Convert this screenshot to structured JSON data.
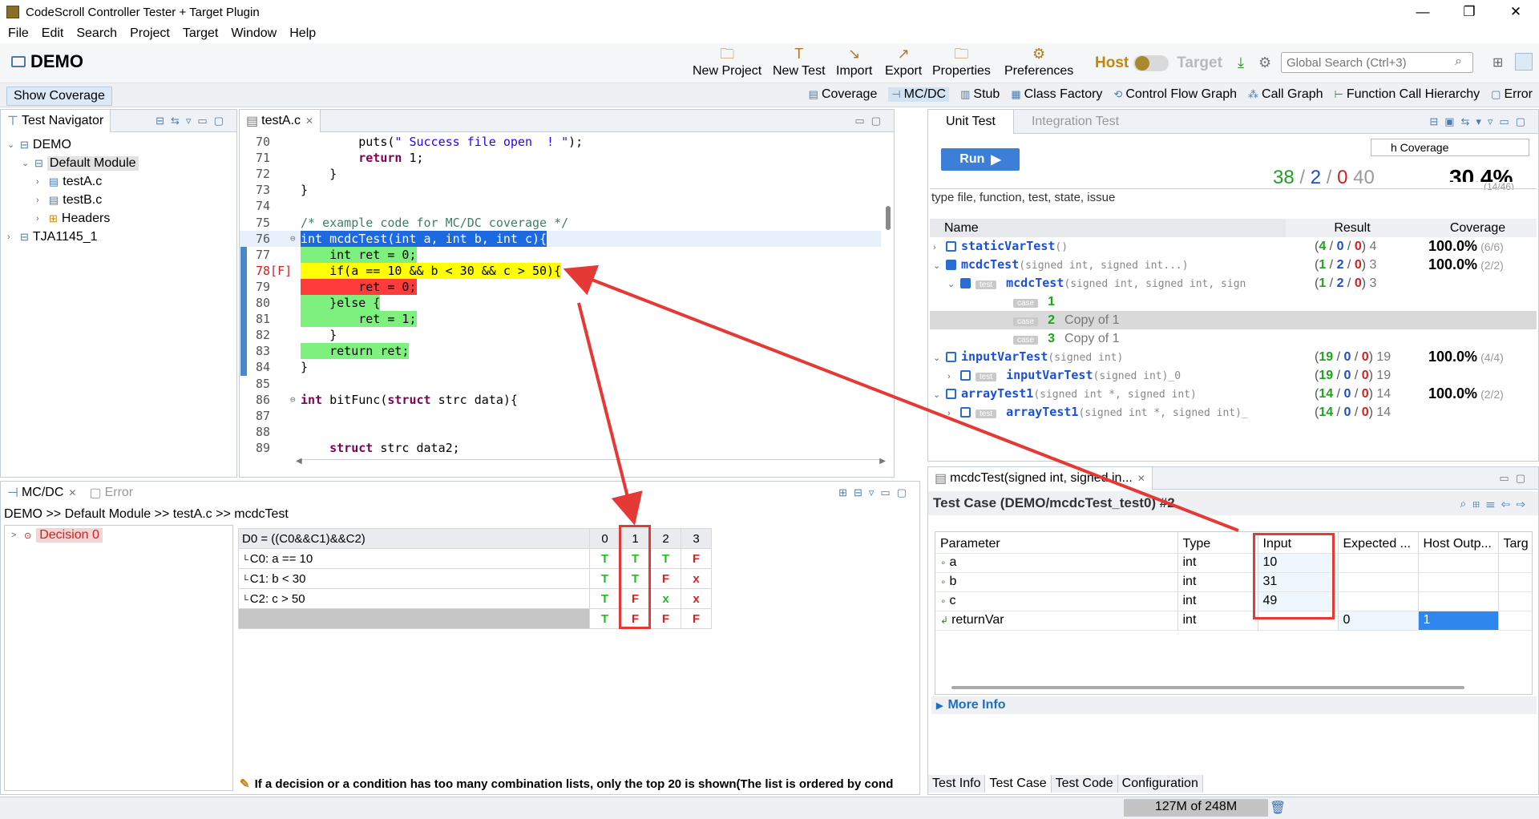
{
  "window": {
    "title": "CodeScroll Controller Tester + Target Plugin",
    "minimize": "—",
    "restore": "❐",
    "close": "✕"
  },
  "menu": [
    "File",
    "Edit",
    "Search",
    "Project",
    "Target",
    "Window",
    "Help"
  ],
  "toolbar": {
    "project": "DEMO",
    "buttons": [
      {
        "label": "New Project",
        "icon": "new-project-icon"
      },
      {
        "label": "New Test",
        "icon": "new-test-icon"
      },
      {
        "label": "Import",
        "icon": "import-icon"
      },
      {
        "label": "Export",
        "icon": "export-icon"
      },
      {
        "label": "Properties",
        "icon": "properties-icon"
      },
      {
        "label": "Preferences",
        "icon": "preferences-icon"
      }
    ],
    "host": "Host",
    "target": "Target",
    "search_placeholder": "Global Search (Ctrl+3)"
  },
  "viewbar": {
    "show_coverage": "Show Coverage",
    "tabs": [
      "Coverage",
      "MC/DC",
      "Stub",
      "Class Factory",
      "Control Flow Graph",
      "Call Graph",
      "Function Call Hierarchy",
      "Error"
    ]
  },
  "navigator": {
    "tab": "Test Navigator",
    "items": [
      {
        "label": "DEMO",
        "indent": 0,
        "expanded": true
      },
      {
        "label": "Default Module",
        "indent": 1,
        "expanded": true,
        "selected": true
      },
      {
        "label": "testA.c",
        "indent": 2
      },
      {
        "label": "testB.c",
        "indent": 2
      },
      {
        "label": "Headers",
        "indent": 2
      },
      {
        "label": "TJA1145_1",
        "indent": 0
      }
    ]
  },
  "editor": {
    "tab": "testA.c",
    "lines": [
      {
        "n": "70",
        "text": "        puts(\" Success file open  ! \");",
        "hl": ""
      },
      {
        "n": "71",
        "text": "        return 1;",
        "hl": ""
      },
      {
        "n": "72",
        "text": "    }",
        "hl": ""
      },
      {
        "n": "73",
        "text": "}",
        "hl": ""
      },
      {
        "n": "74",
        "text": "",
        "hl": ""
      },
      {
        "n": "75",
        "text": "/* example code for MC/DC coverage */",
        "hl": "cmt"
      },
      {
        "n": "76",
        "text": "int mcdcTest(int a, int b, int c){",
        "hl": "blue"
      },
      {
        "n": "77",
        "text": "    int ret = 0;",
        "hl": "green"
      },
      {
        "n": "78[F]",
        "text": "    if(a == 10 && b < 30 && c > 50){",
        "hl": "yellow"
      },
      {
        "n": "79",
        "text": "        ret = 0;",
        "hl": "red"
      },
      {
        "n": "80",
        "text": "    }else {",
        "hl": "green"
      },
      {
        "n": "81",
        "text": "        ret = 1;",
        "hl": "green"
      },
      {
        "n": "82",
        "text": "    }",
        "hl": ""
      },
      {
        "n": "83",
        "text": "    return ret;",
        "hl": "green"
      },
      {
        "n": "84",
        "text": "}",
        "hl": ""
      },
      {
        "n": "85",
        "text": "",
        "hl": ""
      },
      {
        "n": "86",
        "text": "int bitFunc(struct strc data){",
        "hl": ""
      },
      {
        "n": "87",
        "text": "",
        "hl": ""
      },
      {
        "n": "88",
        "text": "",
        "hl": ""
      },
      {
        "n": "89",
        "text": "    struct strc data2;",
        "hl": ""
      }
    ]
  },
  "mcdc": {
    "tab": "MC/DC",
    "tab2": "Error",
    "breadcrumb": "DEMO >> Default Module >> testA.c >> mcdcTest",
    "decision": "Decision 0",
    "header": "D0 = ((C0&&C1)&&C2)",
    "cols": [
      "0",
      "1",
      "2",
      "3"
    ],
    "rows": [
      {
        "label": "C0: a == 10",
        "vals": [
          "T",
          "T",
          "T",
          "F"
        ]
      },
      {
        "label": "C1: b < 30",
        "vals": [
          "T",
          "T",
          "F",
          "x"
        ]
      },
      {
        "label": "C2: c > 50",
        "vals": [
          "T",
          "F",
          "x",
          "x"
        ]
      }
    ],
    "result": [
      "T",
      "F",
      "F",
      "F"
    ],
    "note": "If a decision or a condition has too many combination lists, only the top 20 is shown(The list is ordered by cond"
  },
  "unittest": {
    "tab": "Unit Test",
    "tab2": "Integration Test",
    "run": "Run",
    "cov_select": "h Coverage",
    "summary": {
      "a": "38",
      "b": "2",
      "c": "0",
      "d": "40",
      "pct": "30.4%",
      "sub": "(14/46)"
    },
    "filter": "type file, function, test, state, issue",
    "headers": [
      "Name",
      "Result",
      "Coverage"
    ],
    "rows": [
      {
        "level": 0,
        "tw": ">",
        "check": false,
        "tag": "",
        "name": "staticVarTest",
        "sig": "()",
        "r": [
          "4",
          "0",
          "0",
          "4"
        ],
        "pct": "100.0%",
        "psub": "(6/6)"
      },
      {
        "level": 0,
        "tw": "v",
        "check": true,
        "tag": "",
        "name": "mcdcTest",
        "sig": "(signed int, signed int...)",
        "r": [
          "1",
          "2",
          "0",
          "3"
        ],
        "pct": "100.0%",
        "psub": "(2/2)"
      },
      {
        "level": 1,
        "tw": "v",
        "check": true,
        "tag": "test",
        "name": "mcdcTest",
        "sig": "(signed int, signed int, sign",
        "r": [
          "1",
          "2",
          "0",
          "3"
        ],
        "pct": "",
        "psub": ""
      },
      {
        "level": 2,
        "tw": "",
        "check": false,
        "tag": "case",
        "name": "1",
        "sig": "",
        "r": [],
        "pct": "",
        "psub": "",
        "case": true
      },
      {
        "level": 2,
        "tw": "",
        "check": false,
        "tag": "case",
        "name": "2",
        "sig": "Copy of 1",
        "r": [],
        "pct": "",
        "psub": "",
        "case": true,
        "selected": true
      },
      {
        "level": 2,
        "tw": "",
        "check": false,
        "tag": "case",
        "name": "3",
        "sig": "Copy of 1",
        "r": [],
        "pct": "",
        "psub": "",
        "case": true
      },
      {
        "level": 0,
        "tw": "v",
        "check": false,
        "tag": "",
        "name": "inputVarTest",
        "sig": "(signed int)",
        "r": [
          "19",
          "0",
          "0",
          "19"
        ],
        "pct": "100.0%",
        "psub": "(4/4)"
      },
      {
        "level": 1,
        "tw": ">",
        "check": false,
        "tag": "test",
        "name": "inputVarTest",
        "sig": "(signed int)_0",
        "r": [
          "19",
          "0",
          "0",
          "19"
        ],
        "pct": "",
        "psub": ""
      },
      {
        "level": 0,
        "tw": "v",
        "check": false,
        "tag": "",
        "name": "arrayTest1",
        "sig": "(signed int *, signed int)",
        "r": [
          "14",
          "0",
          "0",
          "14"
        ],
        "pct": "100.0%",
        "psub": "(2/2)"
      },
      {
        "level": 1,
        "tw": ">",
        "check": false,
        "tag": "test",
        "name": "arrayTest1",
        "sig": "(signed int *, signed int)_",
        "r": [
          "14",
          "0",
          "0",
          "14"
        ],
        "pct": "",
        "psub": ""
      }
    ]
  },
  "testcase": {
    "tab": "mcdcTest(signed int, signed in...",
    "title": "Test Case (DEMO/mcdcTest_test0) #2",
    "headers": [
      "Parameter",
      "Type",
      "Input",
      "Expected ...",
      "Host Outp...",
      "Targ"
    ],
    "params": [
      {
        "name": "a",
        "type": "int",
        "input": "10",
        "expected": "",
        "host": ""
      },
      {
        "name": "b",
        "type": "int",
        "input": "31",
        "expected": "",
        "host": ""
      },
      {
        "name": "c",
        "type": "int",
        "input": "49",
        "expected": "",
        "host": ""
      },
      {
        "name": "returnVar",
        "type": "int",
        "input": "",
        "expected": "0",
        "host": "1"
      }
    ],
    "more_info": "More Info",
    "bottom_tabs": [
      "Test Info",
      "Test Case",
      "Test Code",
      "Configuration"
    ]
  },
  "status": {
    "memory": "127M of 248M"
  },
  "colors": {
    "accent": "#1d6ae0",
    "annotation": "#e53935",
    "pass": "#17c417",
    "fail": "#e02020"
  }
}
